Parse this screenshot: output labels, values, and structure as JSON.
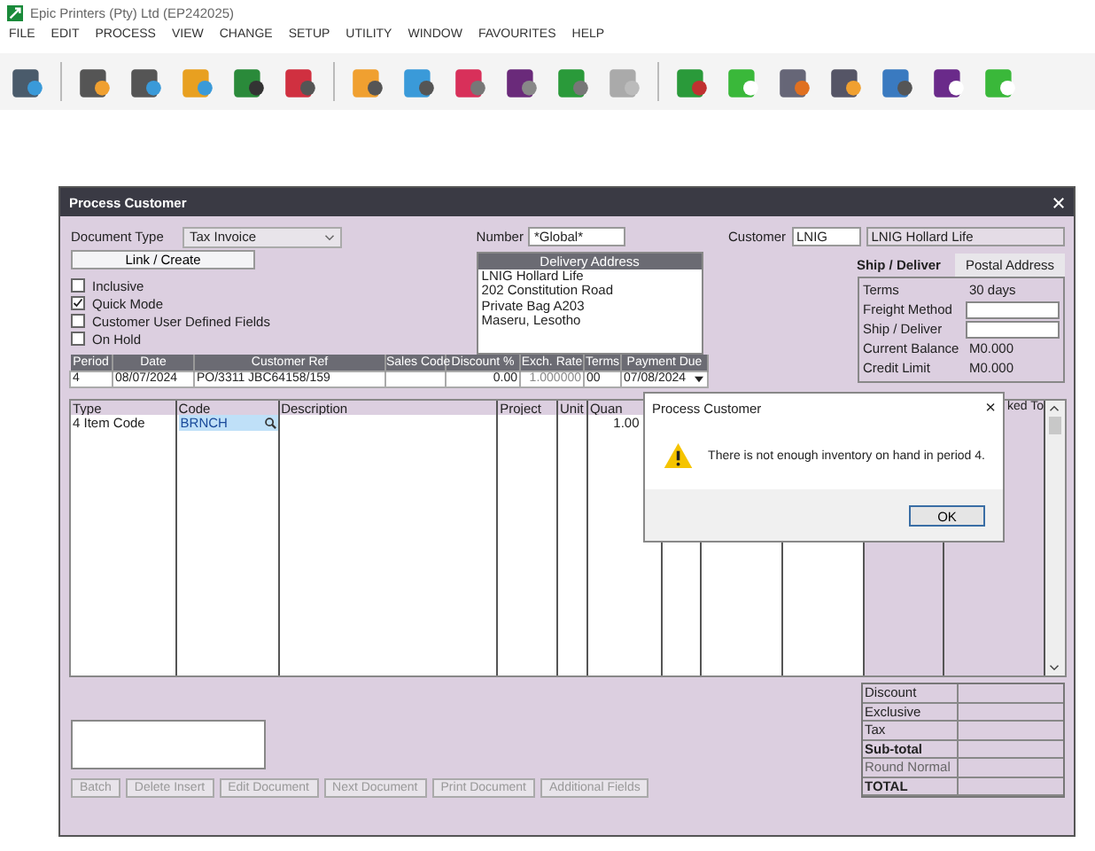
{
  "app": {
    "title": "Epic Printers (Pty) Ltd (EP242025)"
  },
  "menu": [
    "FILE",
    "EDIT",
    "PROCESS",
    "VIEW",
    "CHANGE",
    "SETUP",
    "UTILITY",
    "WINDOW",
    "FAVOURITES",
    "HELP"
  ],
  "dialog": {
    "title": "Process Customer",
    "document_type": {
      "label": "Document Type",
      "value": "Tax Invoice"
    },
    "link_button": "Link / Create",
    "options": [
      {
        "label": "Inclusive",
        "checked": false
      },
      {
        "label": "Quick Mode",
        "checked": true
      },
      {
        "label": "Customer User Defined Fields",
        "checked": false
      },
      {
        "label": "On Hold",
        "checked": false
      }
    ],
    "number": {
      "label": "Number",
      "value": "*Global*"
    },
    "delivery_address": {
      "title": "Delivery Address",
      "lines": [
        "LNIG Hollard Life",
        "202 Constitution Road",
        "Private Bag A203",
        "Maseru, Lesotho"
      ]
    },
    "customer": {
      "label": "Customer",
      "code": "LNIG",
      "name": "LNIG Hollard Life"
    },
    "tabs": [
      {
        "label": "Ship / Deliver",
        "selected": true
      },
      {
        "label": "Postal Address",
        "selected": false
      }
    ],
    "details": [
      {
        "kind": "text",
        "label": "Terms",
        "value": "30 days"
      },
      {
        "kind": "field",
        "label": "Freight Method"
      },
      {
        "kind": "field",
        "label": "Ship / Deliver"
      },
      {
        "kind": "text",
        "label": "Current Balance",
        "value": "M0.000"
      },
      {
        "kind": "text",
        "label": "Credit Limit",
        "value": "M0.000"
      }
    ],
    "header_table": [
      {
        "label": "Period",
        "value": "4"
      },
      {
        "label": "Date",
        "value": "08/07/2024"
      },
      {
        "label": "Customer Ref",
        "value": "PO/3311 JBC64158/159"
      },
      {
        "label": "Sales Code"
      },
      {
        "label": "Discount %",
        "value": "0.00"
      },
      {
        "label": "Exch. Rate",
        "value": "1.000000"
      },
      {
        "label": "Terms",
        "value": "00"
      },
      {
        "label": "Payment Due",
        "value": "07/08/2024"
      }
    ],
    "lines": {
      "columns": [
        "Type",
        "Code",
        "Description",
        "Project",
        "Unit",
        "Quan",
        null,
        null,
        null,
        null,
        "ked To"
      ],
      "rows": [
        {
          "cells": [
            "4  Item Code",
            "BRNCH",
            null,
            null,
            null,
            "1.00",
            null,
            null,
            null,
            null,
            null
          ],
          "code_selected": true
        }
      ]
    },
    "totals": [
      "Discount",
      "Exclusive",
      "Tax",
      "Sub-total",
      "Round Normal",
      "TOTAL"
    ],
    "buttons": [
      {
        "label": "Batch",
        "disabled": true
      },
      {
        "label": "Delete Insert",
        "disabled": true
      },
      {
        "label": "Edit Document",
        "disabled": true
      },
      {
        "label": "Next Document",
        "disabled": true
      },
      {
        "label": "Print Document",
        "disabled": true
      },
      {
        "label": "Additional Fields",
        "disabled": true
      }
    ]
  },
  "message_box": {
    "title": "Process Customer",
    "close": "×",
    "message": "There is not enough inventory on hand in period 4.",
    "button": "OK"
  }
}
